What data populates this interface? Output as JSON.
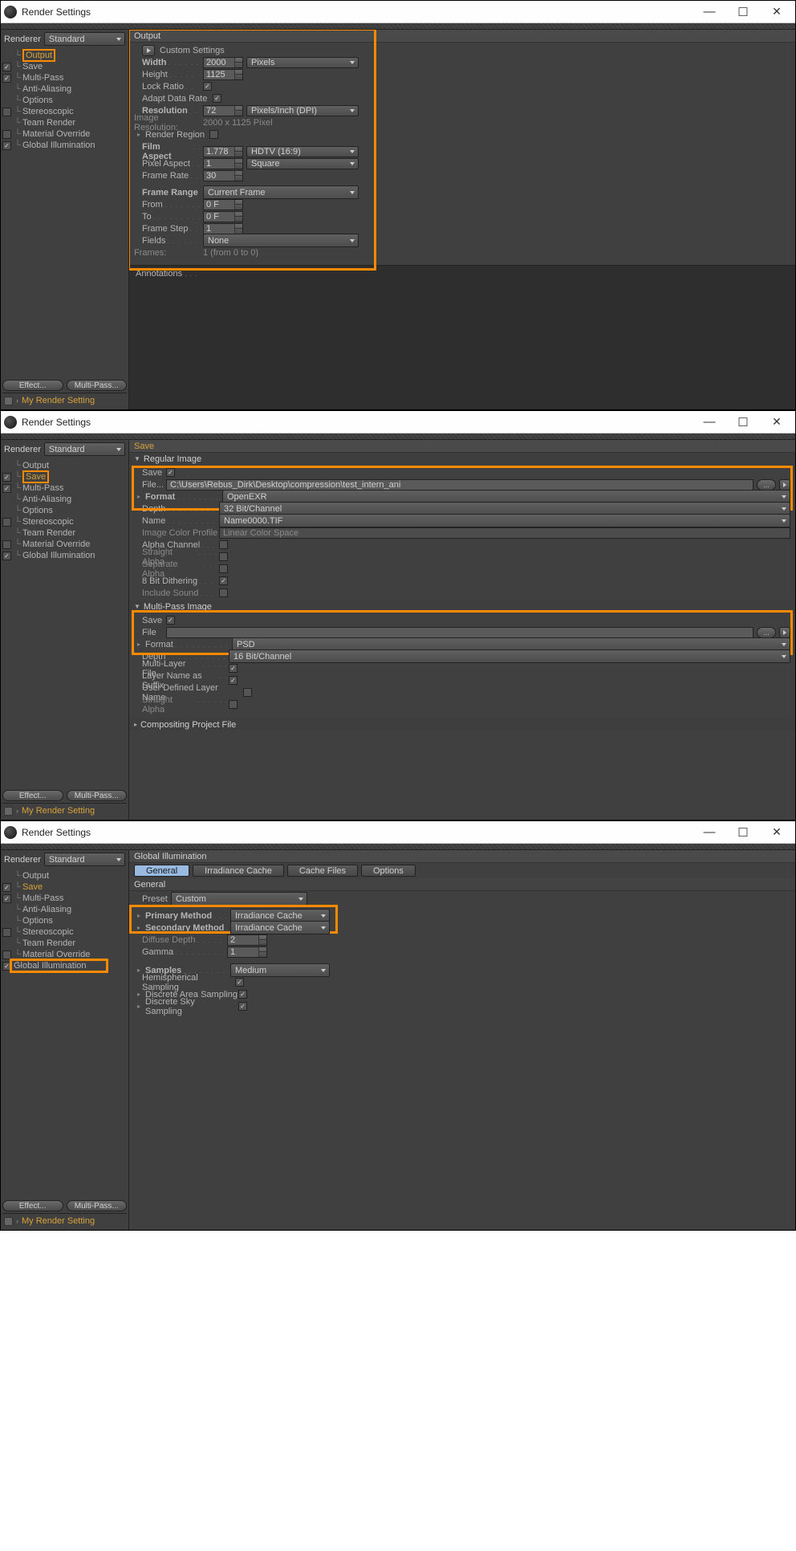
{
  "title": "Render Settings",
  "win_buttons": {
    "min": "—",
    "max": "☐",
    "close": "✕"
  },
  "buttons": {
    "effect": "Effect...",
    "multipass": "Multi-Pass...",
    "browse": "..."
  },
  "renderer": {
    "label": "Renderer",
    "value": "Standard"
  },
  "preset_name": "My Render Setting",
  "sidebar1": [
    {
      "cb": "",
      "label": "Output",
      "sel": true,
      "hi": true
    },
    {
      "cb": "✓",
      "label": "Save"
    },
    {
      "cb": "✓",
      "label": "Multi-Pass"
    },
    {
      "cb": "",
      "label": "Anti-Aliasing"
    },
    {
      "cb": "",
      "label": "Options"
    },
    {
      "cb": "off",
      "label": "Stereoscopic"
    },
    {
      "cb": "",
      "label": "Team Render"
    },
    {
      "cb": "off",
      "label": "Material Override"
    },
    {
      "cb": "✓",
      "label": "Global Illumination"
    }
  ],
  "output": {
    "title": "Output",
    "custom": "Custom Settings",
    "width_l": "Width",
    "width_v": "2000",
    "width_u": "Pixels",
    "height_l": "Height",
    "height_v": "1125",
    "lock_l": "Lock Ratio",
    "adapt_l": "Adapt Data Rate",
    "res_l": "Resolution",
    "res_v": "72",
    "res_u": "Pixels/Inch (DPI)",
    "imgres_l": "Image Resolution:",
    "imgres_v": "2000 x 1125 Pixel",
    "region_l": "Render Region",
    "film_l": "Film Aspect",
    "film_v": "1.778",
    "film_u": "HDTV (16:9)",
    "pix_l": "Pixel Aspect",
    "pix_v": "1",
    "pix_u": "Square",
    "fps_l": "Frame Rate",
    "fps_v": "30",
    "range_l": "Frame Range",
    "range_v": "Current Frame",
    "from_l": "From",
    "from_v": "0 F",
    "to_l": "To",
    "to_v": "0 F",
    "step_l": "Frame Step",
    "step_v": "1",
    "fields_l": "Fields",
    "fields_v": "None",
    "frames_l": "Frames:",
    "frames_v": "1 (from 0 to 0)",
    "anno": "Annotations"
  },
  "sidebar2": [
    {
      "cb": "",
      "label": "Output"
    },
    {
      "cb": "✓",
      "label": "Save",
      "sel": true,
      "hi": true
    },
    {
      "cb": "✓",
      "label": "Multi-Pass"
    },
    {
      "cb": "",
      "label": "Anti-Aliasing"
    },
    {
      "cb": "",
      "label": "Options"
    },
    {
      "cb": "off",
      "label": "Stereoscopic"
    },
    {
      "cb": "",
      "label": "Team Render"
    },
    {
      "cb": "off",
      "label": "Material Override"
    },
    {
      "cb": "✓",
      "label": "Global Illumination"
    }
  ],
  "save": {
    "title": "Save",
    "reg_header": "Regular Image",
    "save_l": "Save",
    "file_l": "File...",
    "file_v": "C:\\Users\\Rebus_Dirk\\Desktop\\compression\\test_intern_ani",
    "fmt_l": "Format",
    "fmt_v": "OpenEXR",
    "depth_l": "Depth",
    "depth_v": "32 Bit/Channel",
    "name_l": "Name",
    "name_v": "Name0000.TIF",
    "icp_l": "Image Color Profile",
    "icp_v": "Linear Color Space",
    "alpha_l": "Alpha Channel",
    "stra_l": "Straight Alpha",
    "sepa_l": "Separate Alpha",
    "dith_l": "8 Bit Dithering",
    "snd_l": "Include Sound",
    "mp_header": "Multi-Pass Image",
    "mp_save_l": "Save",
    "mp_file_l": "File",
    "mp_file_v": "",
    "mp_fmt_l": "Format",
    "mp_fmt_v": "PSD",
    "mp_depth_l": "Depth",
    "mp_depth_v": "16 Bit/Channel",
    "mlf_l": "Multi-Layer File",
    "lns_l": "Layer Name as Suffix",
    "udn_l": "User Defined Layer Name",
    "mp_stra_l": "Straight Alpha",
    "cpf_header": "Compositing Project File"
  },
  "sidebar3": [
    {
      "cb": "",
      "label": "Output"
    },
    {
      "cb": "✓",
      "label": "Save",
      "sel": true
    },
    {
      "cb": "✓",
      "label": "Multi-Pass"
    },
    {
      "cb": "",
      "label": "Anti-Aliasing"
    },
    {
      "cb": "",
      "label": "Options"
    },
    {
      "cb": "off",
      "label": "Stereoscopic"
    },
    {
      "cb": "",
      "label": "Team Render"
    },
    {
      "cb": "off",
      "label": "Material Override"
    },
    {
      "cb": "✓",
      "label": "Global Illumination",
      "hi": true
    }
  ],
  "gi": {
    "title": "Global Illumination",
    "tabs": [
      "General",
      "Irradiance Cache",
      "Cache Files",
      "Options"
    ],
    "gen": "General",
    "preset_l": "Preset",
    "preset_v": "Custom",
    "prim_l": "Primary Method",
    "prim_v": "Irradiance Cache",
    "sec_l": "Secondary Method",
    "sec_v": "Irradiance Cache",
    "dd_l": "Diffuse Depth",
    "dd_v": "2",
    "gamma_l": "Gamma",
    "gamma_v": "1",
    "samples_l": "Samples",
    "samples_v": "Medium",
    "hs_l": "Hemispherical Sampling",
    "das_l": "Discrete Area Sampling",
    "dss_l": "Discrete Sky Sampling"
  }
}
